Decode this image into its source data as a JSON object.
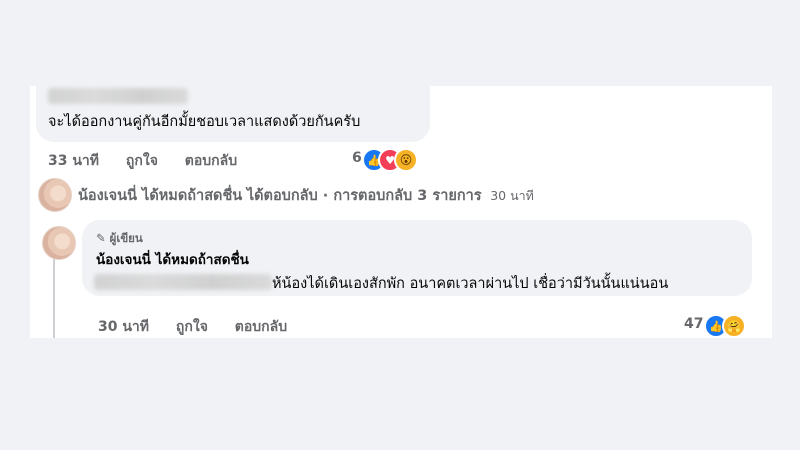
{
  "comment1": {
    "text": "จะได้ออกงานคู่กันอีกมั้ยชอบเวลาแสดงด้วยกันครับ",
    "time": "33 นาที",
    "like_label": "ถูกใจ",
    "reply_label": "ตอบกลับ",
    "reaction_count": "6"
  },
  "replies_summary": {
    "author": "น้องเจนนี่ ได้หมดถ้าสดชื่น",
    "action": "ได้ตอบกลับ · การตอบกลับ 3 รายการ",
    "time": "30 นาที"
  },
  "reply": {
    "badge": "ผู้เขียน",
    "author": "น้องเจนนี่ ได้หมดถ้าสดชื่น",
    "text": "ห้น้องได้เดินเองสักพัก อนาคตเวลาผ่านไป เชื่อว่ามีวันนั้นแน่นอน",
    "time": "30 นาที",
    "like_label": "ถูกใจ",
    "reply_label": "ตอบกลับ",
    "reaction_count": "47"
  },
  "icons": {
    "badge_icon": "pencil-icon",
    "reactions1": [
      "like-icon",
      "love-icon",
      "wow-icon"
    ],
    "reactions2": [
      "like-icon",
      "care-icon"
    ]
  },
  "colors": {
    "like": "#1877f2",
    "love": "#f33e58",
    "wow": "#f7b125",
    "meta_text": "#65676b"
  }
}
